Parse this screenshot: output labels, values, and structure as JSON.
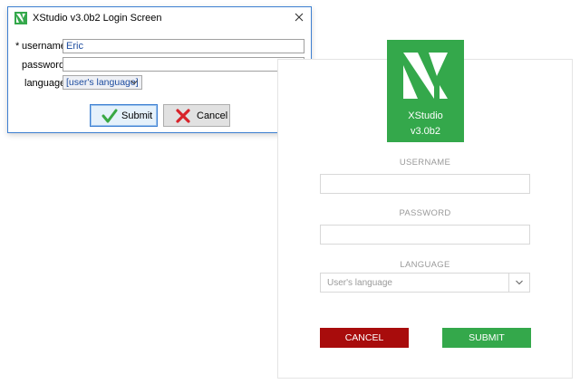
{
  "dialog": {
    "title": "XStudio v3.0b2 Login Screen",
    "required_marker": "*",
    "username_label": "username",
    "username_value": "Eric",
    "password_label": "password",
    "password_value": "",
    "language_label": "language",
    "language_value": "[user's language]",
    "submit_label": "Submit",
    "cancel_label": "Cancel",
    "icons": {
      "logo": "xstudio-logo-icon",
      "close": "close-icon",
      "submit": "checkmark-icon",
      "cancel": "cross-icon",
      "dropdown": "chevron-down-icon"
    }
  },
  "web": {
    "brand_name": "XStudio",
    "brand_version": "v3.0b2",
    "username_label": "USERNAME",
    "username_value": "",
    "password_label": "PASSWORD",
    "password_value": "",
    "language_label": "LANGUAGE",
    "language_value": "User's language",
    "cancel_label": "CANCEL",
    "submit_label": "SUBMIT"
  },
  "colors": {
    "brand_green": "#34a84b",
    "cancel_red": "#a80c0c",
    "dialog_border": "#3d7fd1",
    "input_text": "#1e4da0"
  }
}
